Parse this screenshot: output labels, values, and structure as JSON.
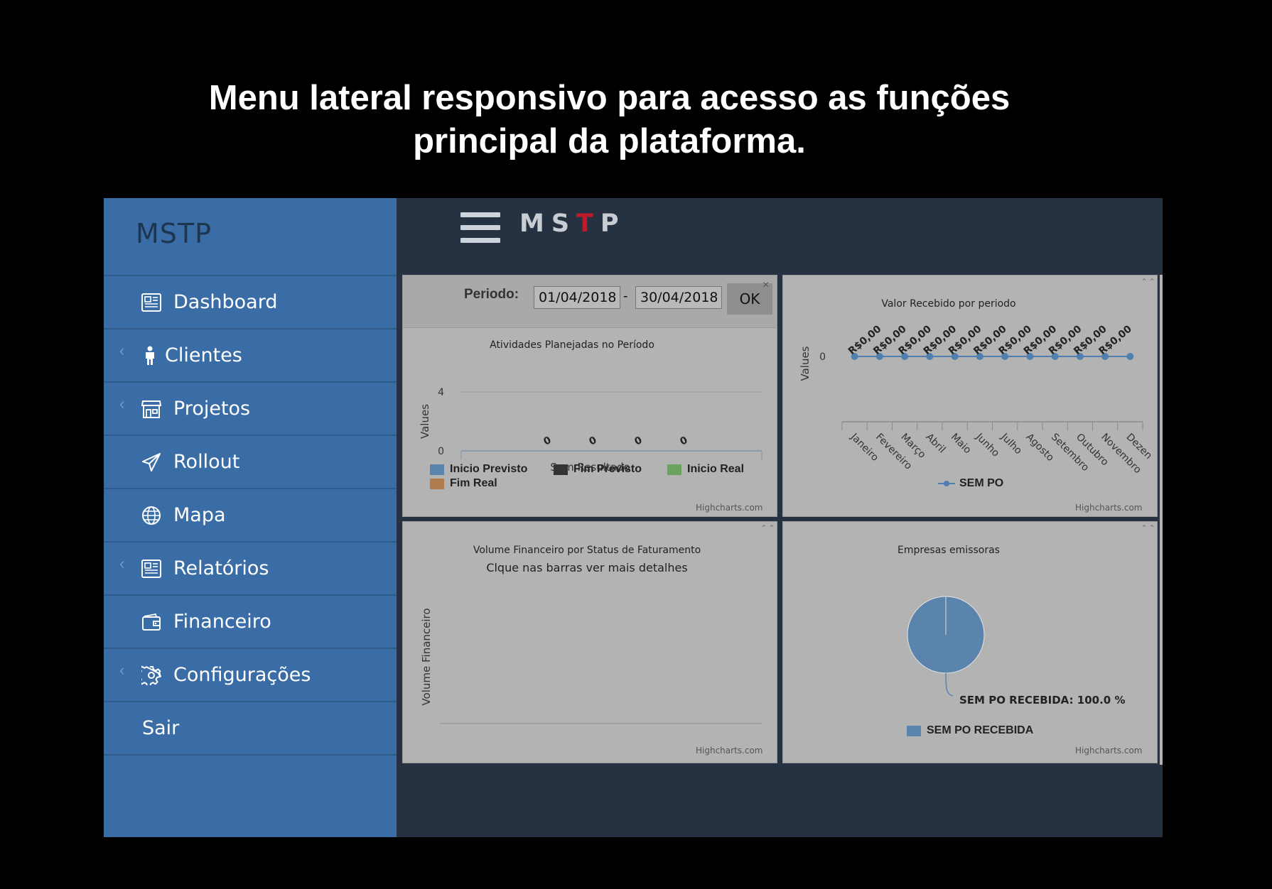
{
  "caption": {
    "line1": "Menu lateral responsivo para acesso as funções",
    "line2": "principal da plataforma."
  },
  "sidebar": {
    "brand": "MSTP",
    "items": [
      {
        "label": "Dashboard",
        "icon": "newspaper-icon",
        "has_chevron": false
      },
      {
        "label": "Clientes",
        "icon": "person-icon",
        "has_chevron": true
      },
      {
        "label": "Projetos",
        "icon": "store-icon",
        "has_chevron": true
      },
      {
        "label": "Rollout",
        "icon": "paper-plane-icon",
        "has_chevron": false
      },
      {
        "label": "Mapa",
        "icon": "globe-icon",
        "has_chevron": false
      },
      {
        "label": "Relatórios",
        "icon": "newspaper-icon",
        "has_chevron": true
      },
      {
        "label": "Financeiro",
        "icon": "wallet-icon",
        "has_chevron": false
      },
      {
        "label": "Configurações",
        "icon": "gear-icon",
        "has_chevron": true
      },
      {
        "label": "Sair",
        "icon": "",
        "has_chevron": false
      }
    ]
  },
  "topbar": {
    "logo_pre": "MS",
    "logo_accent": "T",
    "logo_post": "P",
    "accent_color": "#c01a2a"
  },
  "filter": {
    "label": "Periodo:",
    "start_date": "01/04/2018",
    "separator": "-",
    "end_date": "30/04/2018",
    "ok_label": "OK",
    "close_glyph": "×"
  },
  "credit": "Highcharts.com",
  "chart_data": [
    {
      "type": "bar",
      "title": "Atividades Planejadas no Período",
      "ylabel": "Values",
      "xlabel": "Sem Resultado",
      "ylim": [
        0,
        4
      ],
      "yticks": [
        "4",
        "0"
      ],
      "series": [
        {
          "name": "Inicio Previsto",
          "color": "#5b84ad",
          "values": [
            0
          ]
        },
        {
          "name": "Fim Previsto",
          "color": "#333333",
          "values": [
            0
          ]
        },
        {
          "name": "Inicio Real",
          "color": "#6aa35d",
          "values": [
            0
          ]
        },
        {
          "name": "Fim Real",
          "color": "#b07c4e",
          "values": [
            0
          ]
        }
      ],
      "data_labels": [
        "0",
        "0",
        "0",
        "0"
      ]
    },
    {
      "type": "line",
      "title": "Valor Recebido por periodo",
      "ylabel": "Values",
      "yticks": [
        "0"
      ],
      "categories": [
        "Janeiro",
        "Fevereiro",
        "Março",
        "Abril",
        "Maio",
        "Junho",
        "Julho",
        "Agosto",
        "Setembro",
        "Outubro",
        "Novembro",
        "Dezen"
      ],
      "series": [
        {
          "name": "SEM PO",
          "color": "#4f7fb0",
          "values": [
            0,
            0,
            0,
            0,
            0,
            0,
            0,
            0,
            0,
            0,
            0,
            0
          ]
        }
      ],
      "data_labels": [
        "R$0,00",
        "R$0,00",
        "R$0,00",
        "R$0,00",
        "R$0,00",
        "R$0,00",
        "R$0,00",
        "R$0,00",
        "R$0,00",
        "R$0,00",
        "R$0,00"
      ]
    },
    {
      "type": "bar",
      "title": "Volume Financeiro por Status de Faturamento",
      "subtitle": "Clque nas barras ver mais detalhes",
      "ylabel": "Volume Financeiro",
      "series": []
    },
    {
      "type": "pie",
      "title": "Empresas emissoras",
      "slices": [
        {
          "name": "SEM PO RECEBIDA",
          "value": 100.0,
          "color": "#5b84ad"
        }
      ],
      "data_label": "SEM PO RECEBIDA: 100.0 %"
    }
  ]
}
